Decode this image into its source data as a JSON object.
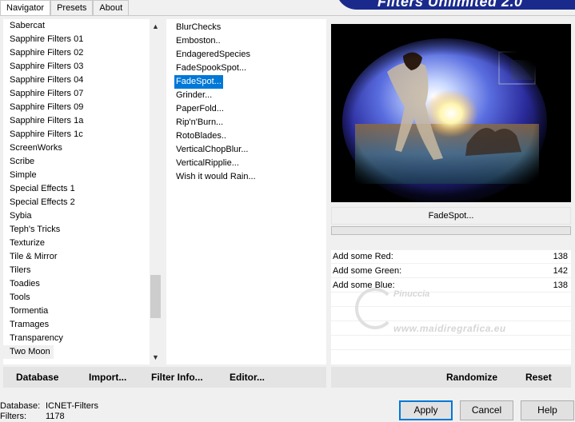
{
  "tabs": [
    "Navigator",
    "Presets",
    "About"
  ],
  "banner_title": "Filters Unlimited 2.0",
  "categories": [
    "Sabercat",
    "Sapphire Filters 01",
    "Sapphire Filters 02",
    "Sapphire Filters 03",
    "Sapphire Filters 04",
    "Sapphire Filters 07",
    "Sapphire Filters 09",
    "Sapphire Filters 1a",
    "Sapphire Filters 1c",
    "ScreenWorks",
    "Scribe",
    "Simple",
    "Special Effects 1",
    "Special Effects 2",
    "Sybia",
    "Teph's Tricks",
    "Texturize",
    "Tile & Mirror",
    "Tilers",
    "Toadies",
    "Tools",
    "Tormentia",
    "Tramages",
    "Transparency",
    "Two Moon"
  ],
  "highlighted_category": "Two Moon",
  "filters": [
    "BlurChecks",
    "Emboston..",
    "EndageredSpecies",
    "FadeSpookSpot...",
    "FadeSpot...",
    "Grinder...",
    "PaperFold...",
    "Rip'n'Burn...",
    "RotoBlades..",
    "VerticalChopBlur...",
    "VerticalRipplie...",
    "Wish it would Rain..."
  ],
  "selected_filter": "FadeSpot...",
  "filter_name": "FadeSpot...",
  "controls": [
    {
      "label": "Add some Red:",
      "value": "138"
    },
    {
      "label": "Add some Green:",
      "value": "142"
    },
    {
      "label": "Add some Blue:",
      "value": "138"
    }
  ],
  "watermark": {
    "name": "Pinuccia",
    "site": "www.maidiregrafica.eu"
  },
  "left_buttons": [
    "Database",
    "Import...",
    "Filter Info...",
    "Editor..."
  ],
  "right_buttons": [
    "Randomize",
    "Reset"
  ],
  "status": {
    "database_label": "Database:",
    "database_value": "ICNET-Filters",
    "filters_label": "Filters:",
    "filters_value": "1178"
  },
  "dialog_buttons": {
    "apply": "Apply",
    "cancel": "Cancel",
    "help": "Help"
  },
  "colors": {
    "selection": "#0078d7",
    "banner": "#1a2a8c"
  }
}
